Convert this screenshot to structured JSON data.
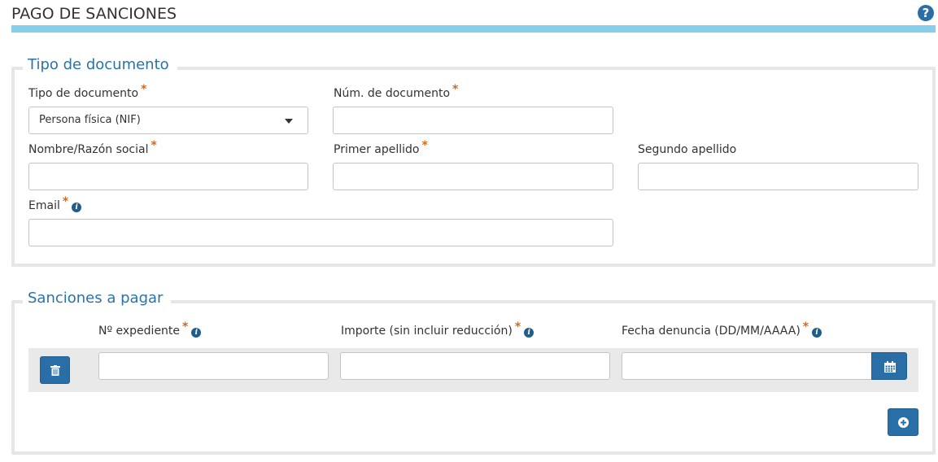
{
  "header": {
    "title": "PAGO DE SANCIONES",
    "help_icon": "question-circle-icon"
  },
  "colors": {
    "accent": "#87ceeb",
    "primary_button": "#2a6ea8",
    "legend_text": "#2a73a8",
    "required_marker": "#d2691e"
  },
  "document_section": {
    "legend": "Tipo de documento",
    "doc_type_label": "Tipo de documento",
    "doc_type_selected": "Persona física (NIF)",
    "doc_number_label": "Núm. de documento",
    "doc_number_value": "",
    "name_label": "Nombre/Razón social",
    "name_value": "",
    "first_surname_label": "Primer apellido",
    "first_surname_value": "",
    "second_surname_label": "Segundo apellido",
    "second_surname_value": "",
    "email_label": "Email",
    "email_value": "",
    "required_marker": "*"
  },
  "sanctions_section": {
    "legend": "Sanciones a pagar",
    "col_file_number": "Nº expediente",
    "col_amount": "Importe (sin incluir reducción)",
    "col_date": "Fecha denuncia (DD/MM/AAAA)",
    "rows": [
      {
        "file_number": "",
        "amount": "",
        "date": ""
      }
    ],
    "delete_icon": "trash-icon",
    "calendar_icon": "calendar-icon",
    "add_icon": "plus-circle-icon"
  }
}
